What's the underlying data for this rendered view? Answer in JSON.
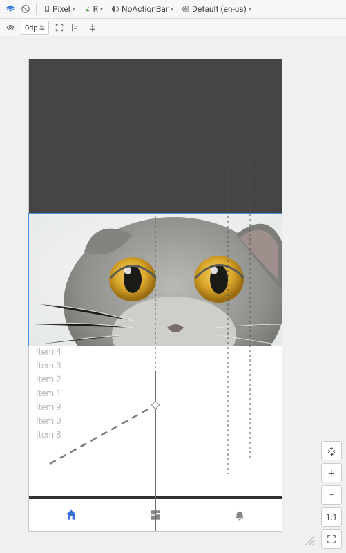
{
  "topbar": {
    "device": "Pixel",
    "api": "R",
    "theme": "NoActionBar",
    "locale": "Default (en-us)"
  },
  "secondbar": {
    "dp_value": "0dp"
  },
  "list": {
    "items": [
      "Item 4",
      "Item 3",
      "Item 2",
      "Item 1",
      "Item 9",
      "Item 0",
      "Item 8"
    ]
  },
  "controls": {
    "one_to_one": "1:1"
  }
}
